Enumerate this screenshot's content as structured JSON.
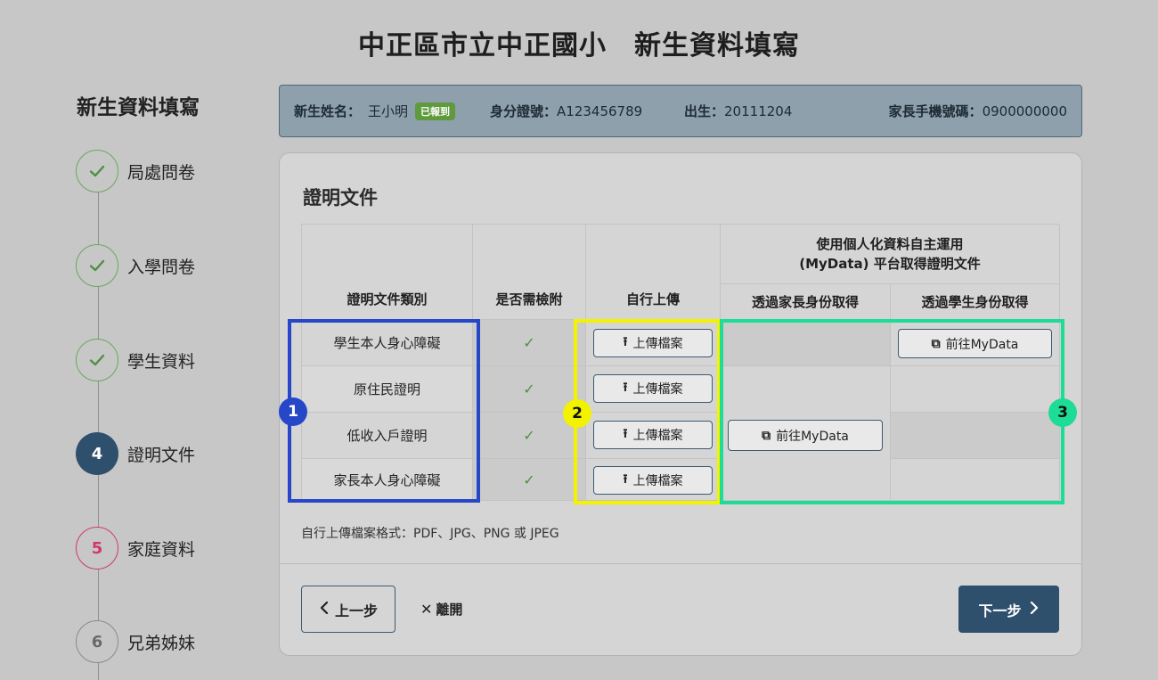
{
  "page": {
    "title": "中正區市立中正國小　新生資料填寫"
  },
  "sidebar": {
    "title": "新生資料填寫",
    "steps": [
      {
        "label": "局處問卷",
        "status": "done",
        "marker": "✓"
      },
      {
        "label": "入學問卷",
        "status": "done",
        "marker": "✓"
      },
      {
        "label": "學生資料",
        "status": "done",
        "marker": "✓"
      },
      {
        "label": "證明文件",
        "status": "active",
        "marker": "4"
      },
      {
        "label": "家庭資料",
        "status": "next",
        "marker": "5"
      },
      {
        "label": "兄弟姊妹",
        "status": "todo",
        "marker": "6"
      }
    ]
  },
  "info_bar": {
    "name_label": "新生姓名：",
    "name_value": "王小明",
    "badge": "已報到",
    "id_label": "身分證號：",
    "id_value": "A123456789",
    "birth_label": "出生：",
    "birth_value": "20111204",
    "phone_label": "家長手機號碼：",
    "phone_value": "0900000000"
  },
  "card": {
    "title": "證明文件",
    "table": {
      "headers": {
        "doc_type": "證明文件類別",
        "required": "是否需檢附",
        "self_upload": "自行上傳",
        "mydata_group_line1": "使用個人化資料自主運用",
        "mydata_group_line2": "(MyData) 平台取得證明文件",
        "via_parent": "透過家長身份取得",
        "via_student": "透過學生身份取得"
      },
      "rows": [
        {
          "doc_type": "學生本人身心障礙",
          "required": "✓",
          "upload_label": "上傳檔案"
        },
        {
          "doc_type": "原住民證明",
          "required": "✓",
          "upload_label": "上傳檔案"
        },
        {
          "doc_type": "低收入戶證明",
          "required": "✓",
          "upload_label": "上傳檔案"
        },
        {
          "doc_type": "家長本人身心障礙",
          "required": "✓",
          "upload_label": "上傳檔案"
        }
      ],
      "mydata_parent_label": "前往MyData",
      "mydata_student_label": "前往MyData"
    },
    "note": "自行上傳檔案格式：PDF、JPG、PNG 或 JPEG",
    "prev_label": "上一步",
    "leave_label": "離開",
    "next_label": "下一步"
  },
  "annotations": [
    {
      "number": "1",
      "color": "#2747c9"
    },
    {
      "number": "2",
      "color": "#f3f200"
    },
    {
      "number": "3",
      "color": "#1ddc96"
    }
  ]
}
